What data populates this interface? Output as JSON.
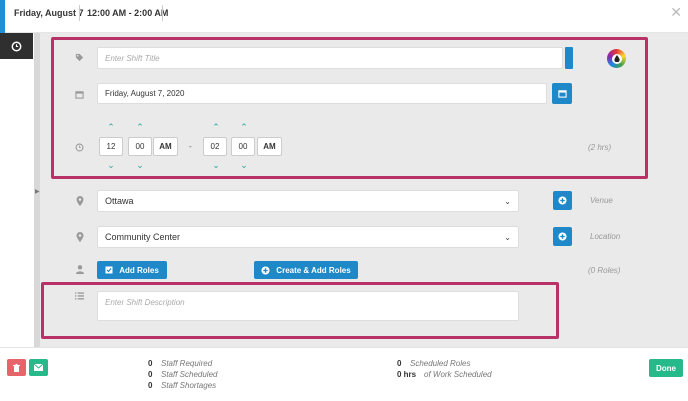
{
  "header": {
    "date": "Friday, August 7",
    "time_range": "12:00 AM - 2:00 AM",
    "close_icon": "close-icon"
  },
  "form": {
    "title": {
      "placeholder": "Enter Shift Title"
    },
    "date": {
      "value": "Friday, August 7, 2020"
    },
    "start_time": {
      "hour": "12",
      "minute": "00",
      "ampm": "AM"
    },
    "end_time": {
      "hour": "02",
      "minute": "00",
      "ampm": "AM"
    },
    "time_dash": "-",
    "duration": "(2 hrs)",
    "venue": {
      "value": "Ottawa",
      "label": "Venue"
    },
    "location": {
      "value": "Community Center",
      "label": "Location"
    },
    "roles": {
      "add_label": "Add Roles",
      "create_label": "Create & Add Roles",
      "count_label": "(0 Roles)"
    },
    "description": {
      "placeholder": "Enter Shift Description"
    }
  },
  "stats": {
    "left": [
      {
        "value": "0",
        "label": "Staff Required"
      },
      {
        "value": "0",
        "label": "Staff Scheduled"
      },
      {
        "value": "0",
        "label": "Staff Shortages"
      }
    ],
    "right": [
      {
        "value": "0",
        "label": "Scheduled Roles"
      },
      {
        "value": "0 hrs",
        "label": "of Work Scheduled"
      }
    ]
  },
  "footer": {
    "done_label": "Done"
  },
  "colors": {
    "accent_blue": "#1e88c8",
    "highlight": "#b83268",
    "done_green": "#26b98a",
    "delete_red": "#e8646a",
    "caret_teal": "#26a69a"
  }
}
